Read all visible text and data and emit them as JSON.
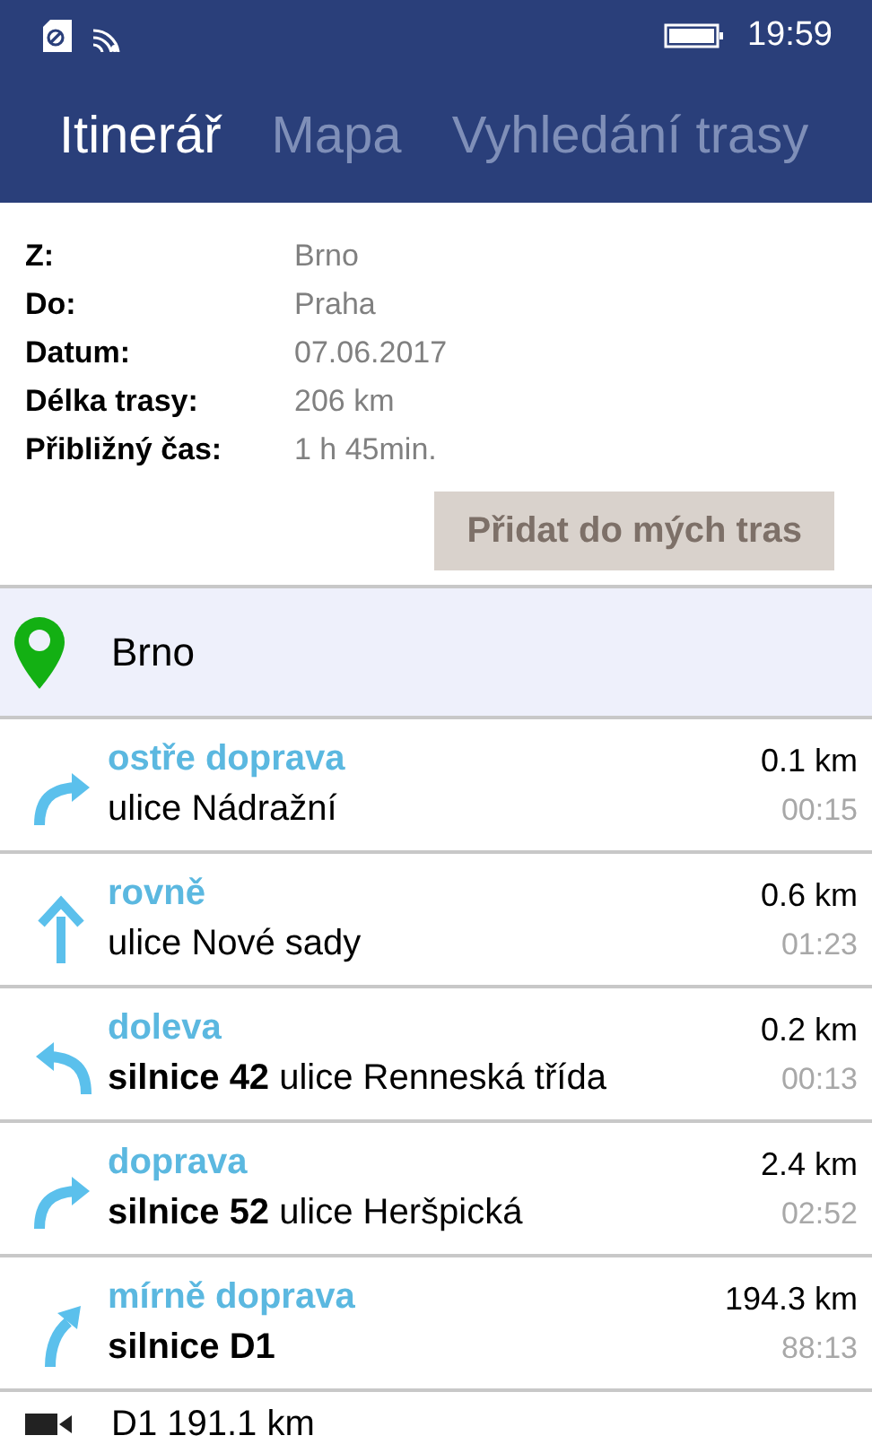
{
  "status_bar": {
    "time": "19:59"
  },
  "tabs": [
    {
      "label": "Itinerář",
      "selected": true
    },
    {
      "label": "Mapa",
      "selected": false
    },
    {
      "label": "Vyhledání trasy",
      "selected": false
    }
  ],
  "summary": [
    {
      "label": "Z:",
      "value": "Brno"
    },
    {
      "label": "Do:",
      "value": "Praha"
    },
    {
      "label": "Datum:",
      "value": "07.06.2017"
    },
    {
      "label": "Délka trasy:",
      "value": "206 km"
    },
    {
      "label": "Přibližný čas:",
      "value": "1 h 45min."
    }
  ],
  "add_button": {
    "label": "Přidat do mých tras",
    "disabled": true
  },
  "start": {
    "place": "Brno"
  },
  "steps": [
    {
      "kind": "sharp_right",
      "instruction": "ostře doprava",
      "street": "ulice Nádražní",
      "distance": "0.1 km",
      "time": "00:15"
    },
    {
      "kind": "straight",
      "instruction": "rovně",
      "street": "ulice Nové sady",
      "distance": "0.6 km",
      "time": "01:23"
    },
    {
      "kind": "left",
      "instruction": "doleva",
      "road": "silnice 42",
      "street": "ulice Renneská třída",
      "distance": "0.2 km",
      "time": "00:13"
    },
    {
      "kind": "right",
      "instruction": "doprava",
      "road": "silnice 52",
      "street": "ulice Heršpická",
      "distance": "2.4 km",
      "time": "02:52"
    },
    {
      "kind": "slight_right",
      "instruction": "mírně doprava",
      "road": "silnice D1",
      "distance": "194.3 km",
      "time": "88:13"
    }
  ],
  "camera": {
    "text": "D1 191.1 km"
  }
}
